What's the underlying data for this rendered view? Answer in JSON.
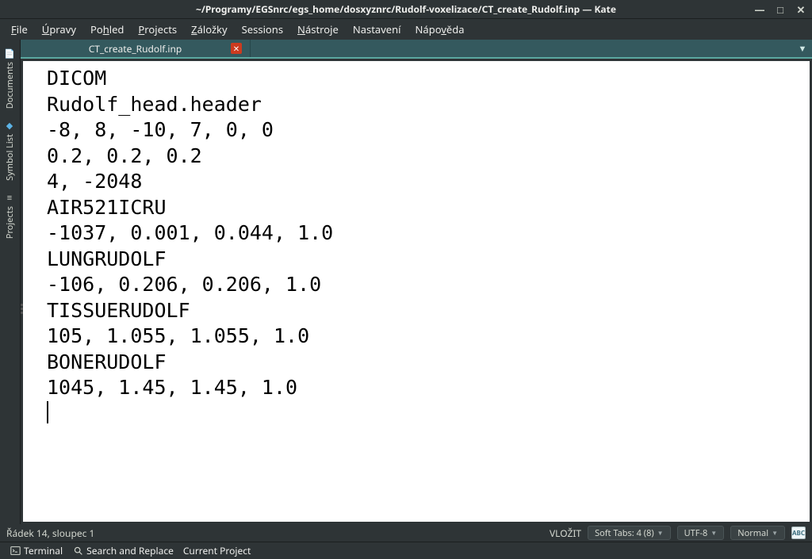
{
  "window": {
    "title": "~/Programy/EGSnrc/egs_home/dosxyznrc/Rudolf-voxelizace/CT_create_Rudolf.inp — Kate"
  },
  "menu": {
    "items": [
      "File",
      "Úpravy",
      "Pohled",
      "Projects",
      "Záložky",
      "Sessions",
      "Nástroje",
      "Nastavení",
      "Nápověda"
    ],
    "mnemonics": [
      "F",
      "Ú",
      "h",
      "P",
      "Z",
      "",
      "N",
      "",
      "v"
    ]
  },
  "sidebar": {
    "items": [
      {
        "label": "Documents",
        "icon": "📄"
      },
      {
        "label": "Symbol List",
        "icon": "◆"
      },
      {
        "label": "Projects",
        "icon": "≡"
      }
    ]
  },
  "tabs": {
    "items": [
      {
        "label": "CT_create_Rudolf.inp",
        "modified": true
      }
    ]
  },
  "editor": {
    "content": "DICOM\nRudolf_head.header\n-8, 8, -10, 7, 0, 0\n0.2, 0.2, 0.2\n4, -2048\nAIR521ICRU\n-1037, 0.001, 0.044, 1.0\nLUNGRUDOLF\n-106, 0.206, 0.206, 1.0\nTISSUERUDOLF\n105, 1.055, 1.055, 1.0\nBONERUDOLF\n1045, 1.45, 1.45, 1.0\n"
  },
  "status": {
    "cursor": "Řádek 14, sloupec 1",
    "insert_mode": "VLOŽIT",
    "indent": "Soft Tabs: 4 (8)",
    "encoding": "UTF-8",
    "mode": "Normal",
    "spellcheck_label": "ABC"
  },
  "bottom": {
    "terminal": "Terminal",
    "search": "Search and Replace",
    "project": "Current Project"
  },
  "window_controls": {
    "minimize": "—",
    "maximize": "□",
    "close": "✕"
  }
}
